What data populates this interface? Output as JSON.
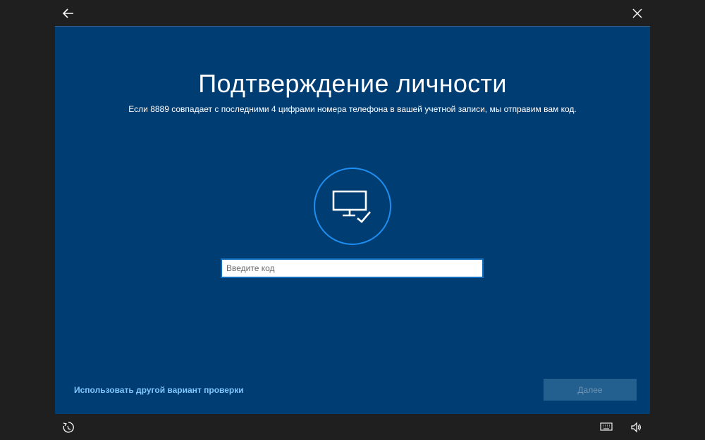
{
  "header": {
    "back_icon": "arrow-left-icon",
    "close_icon": "close-icon"
  },
  "main": {
    "title": "Подтверждение личности",
    "subtitle": "Если 8889 совпадает с последними 4 цифрами номера телефона в вашей учетной записи, мы отправим вам код.",
    "device_icon": "monitor-check-icon",
    "code_input": {
      "placeholder": "Введите код",
      "value": ""
    },
    "alt_link": "Использовать другой вариант проверки",
    "next_label": "Далее"
  },
  "footer": {
    "ease_icon": "ease-of-access-icon",
    "keyboard_icon": "keyboard-icon",
    "volume_icon": "volume-icon"
  },
  "colors": {
    "panel_bg": "#003d73",
    "accent": "#1e8ef0",
    "link": "#7fc6ff",
    "button_disabled_bg": "#24608f",
    "frame_bg": "#1f1f1f"
  }
}
